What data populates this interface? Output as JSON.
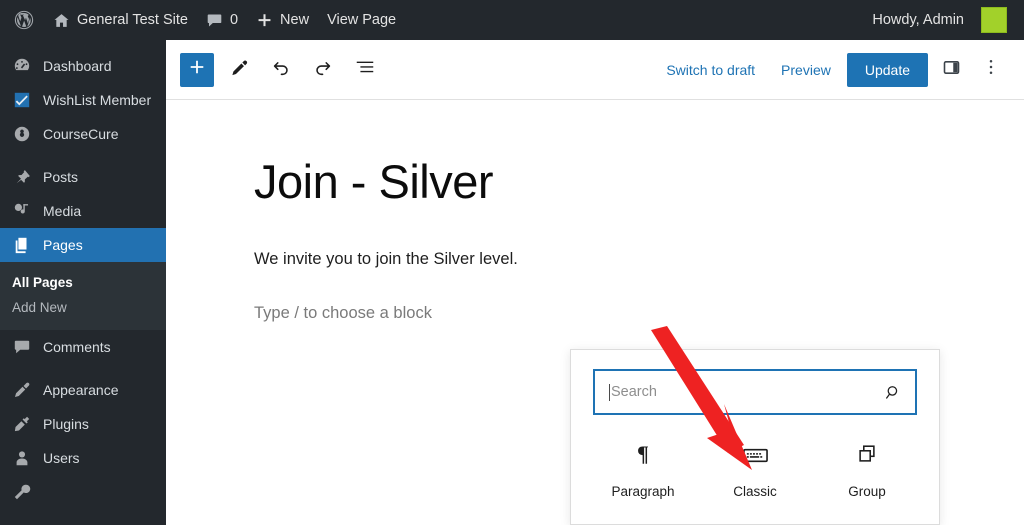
{
  "adminbar": {
    "logo_icon": "wordpress-logo-icon",
    "home_icon": "home-icon",
    "site_name": "General Test Site",
    "comments_icon": "comment-bubble-icon",
    "comments_count": "0",
    "new_icon": "plus-icon",
    "new_label": "New",
    "view_page_label": "View Page",
    "howdy": "Howdy, Admin",
    "avatar_color": "#a2d12a"
  },
  "sidebar": {
    "items": [
      {
        "label": "Dashboard",
        "icon": "dashboard-icon",
        "current": false
      },
      {
        "label": "WishList Member",
        "icon": "checkmark-icon",
        "current": false
      },
      {
        "label": "CourseCure",
        "icon": "coursecure-icon",
        "current": false
      },
      {
        "label": "Posts",
        "icon": "pin-icon",
        "current": false
      },
      {
        "label": "Media",
        "icon": "media-icon",
        "current": false
      },
      {
        "label": "Pages",
        "icon": "pages-icon",
        "current": true
      },
      {
        "label": "Comments",
        "icon": "comment-bubble-icon",
        "current": false
      },
      {
        "label": "Appearance",
        "icon": "paintbrush-icon",
        "current": false
      },
      {
        "label": "Plugins",
        "icon": "plug-icon",
        "current": false
      },
      {
        "label": "Users",
        "icon": "user-icon",
        "current": false
      }
    ],
    "submenu": [
      {
        "label": "All Pages",
        "current": true
      },
      {
        "label": "Add New",
        "current": false
      }
    ],
    "active_color": "#2271b1"
  },
  "toolbar": {
    "add_block_icon": "plus-icon",
    "add_block_color": "#1e73b4",
    "tools_icon": "pencil-icon",
    "undo_icon": "undo-arrow-icon",
    "redo_icon": "redo-arrow-icon",
    "list_view_icon": "list-view-icon",
    "switch_to_draft_label": "Switch to draft",
    "preview_label": "Preview",
    "update_label": "Update",
    "sidebar_toggle_icon": "sidebar-panel-icon",
    "options_icon": "three-dots-vertical-icon",
    "link_color": "#1e73b4"
  },
  "canvas": {
    "title": "Join - Silver",
    "paragraph": "We invite you to join the Silver level.",
    "placeholder": "Type / to choose a block",
    "appender_icon": "plus-icon"
  },
  "inserter": {
    "search": {
      "placeholder": "Search",
      "icon": "search-magnifier-icon",
      "focus_color": "#1e73b4"
    },
    "blocks": [
      {
        "label": "Paragraph",
        "icon": "pilcrow-icon"
      },
      {
        "label": "Classic",
        "icon": "keyboard-icon"
      },
      {
        "label": "Group",
        "icon": "group-squares-icon"
      }
    ]
  },
  "annotation": {
    "arrow_icon": "red-arrow-pointer",
    "arrow_color": "#ee2222"
  }
}
